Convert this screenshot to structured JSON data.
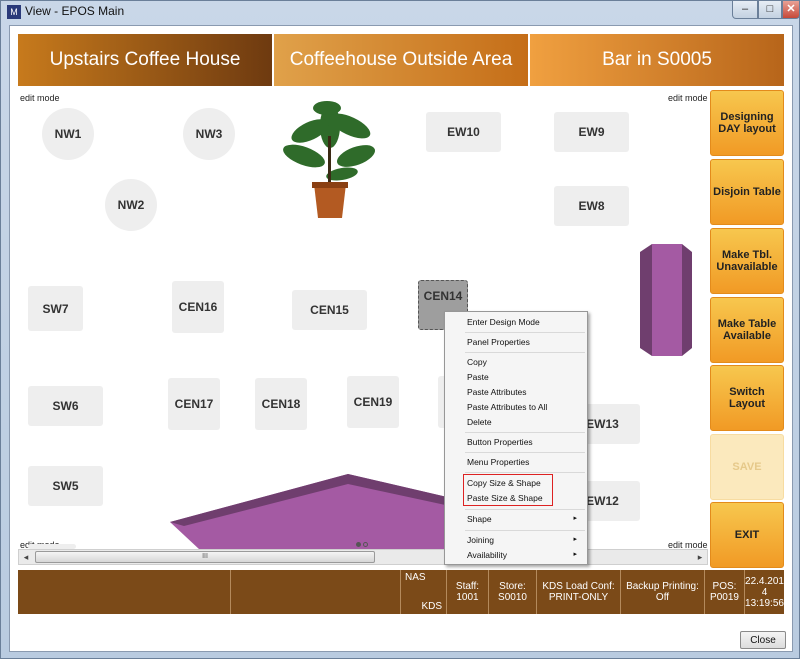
{
  "window": {
    "title": "View - EPOS Main",
    "icon": "app-icon",
    "minimize_glyph": "–",
    "maximize_glyph": "□",
    "close_glyph": "✕"
  },
  "top_tabs": [
    {
      "label": "Upstairs Coffee House"
    },
    {
      "label": "Coffeehouse Outside Area"
    },
    {
      "label": "Bar in S0005"
    }
  ],
  "floor": {
    "edit_mode_label": "edit mode",
    "tables": {
      "nw1": "NW1",
      "nw3": "NW3",
      "nw2": "NW2",
      "ew10": "EW10",
      "ew9": "EW9",
      "ew8": "EW8",
      "sw7": "SW7",
      "cen16": "CEN16",
      "cen15": "CEN15",
      "cen14": "CEN14",
      "sw6": "SW6",
      "cen17": "CEN17",
      "cen18": "CEN18",
      "cen19": "CEN19",
      "ew13": "EW13",
      "sw5": "SW5",
      "ew12": "EW12"
    }
  },
  "side_buttons": [
    {
      "label": "Designing DAY layout"
    },
    {
      "label": "Disjoin Table"
    },
    {
      "label": "Make Tbl. Unavailable"
    },
    {
      "label": "Make Table Available"
    },
    {
      "label": "Switch Layout"
    },
    {
      "label": "SAVE"
    },
    {
      "label": "EXIT"
    }
  ],
  "scrollbar": {
    "left": "◂",
    "right": "▸",
    "grip": "III"
  },
  "status": {
    "nas": "NAS",
    "kds": "KDS",
    "staff": "Staff: 1001",
    "store": "Store: S0010",
    "kds_load": "KDS Load Conf: PRINT-ONLY",
    "backup": "Backup Printing: Off",
    "pos": "POS: P0019",
    "datetime": "22.4.201 4 13:19:56"
  },
  "context_menu": {
    "items": [
      "Enter Design Mode",
      "Panel Properties",
      "Copy",
      "Paste",
      "Paste Attributes",
      "Paste Attributes to All",
      "Delete",
      "Button Properties",
      "Menu Properties",
      "Copy Size & Shape",
      "Paste Size & Shape",
      "Shape",
      "Joining",
      "Availability"
    ],
    "submenu_arrow": "▸"
  },
  "close_button": "Close"
}
